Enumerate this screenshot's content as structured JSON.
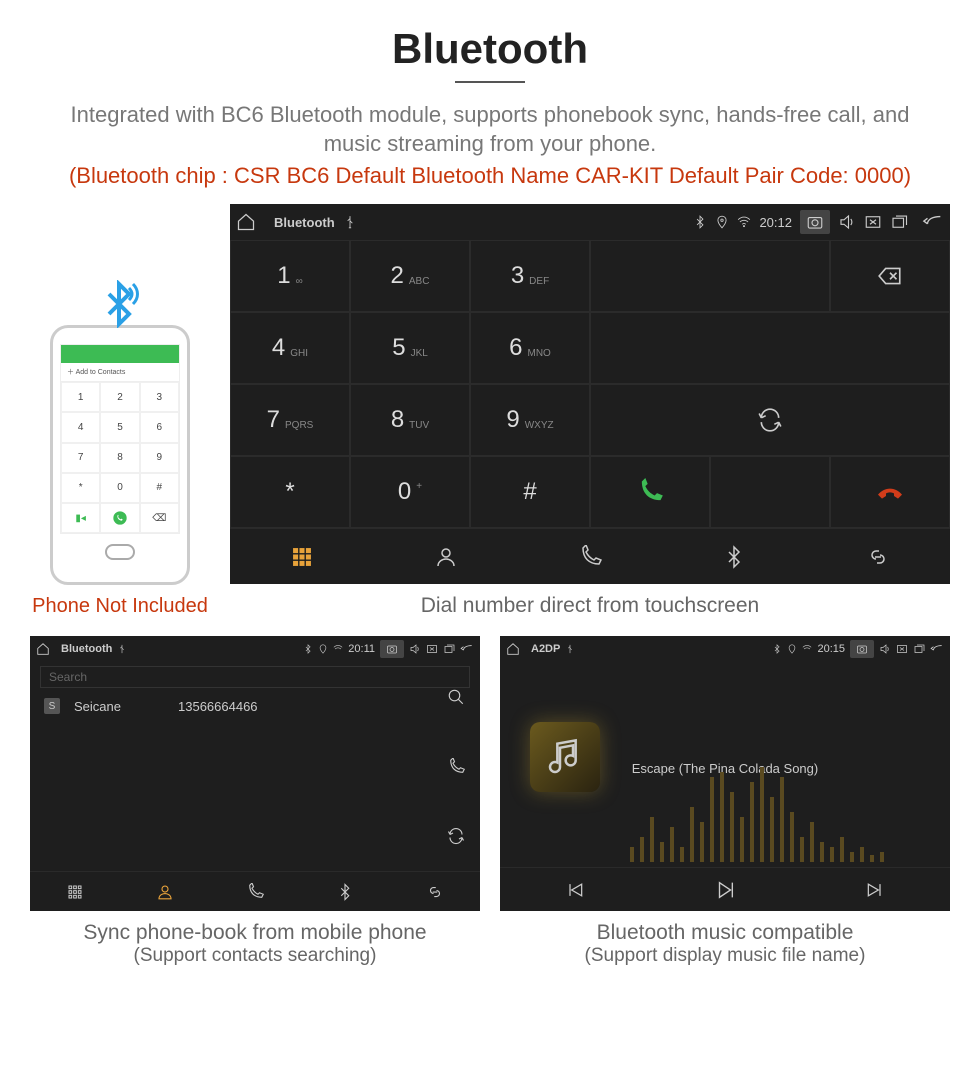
{
  "title": "Bluetooth",
  "description": "Integrated with BC6 Bluetooth module, supports phonebook sync, hands-free call, and music streaming from your phone.",
  "specs": "(Bluetooth chip : CSR BC6     Default Bluetooth Name CAR-KIT     Default Pair Code: 0000)",
  "phone_caption": "Phone Not Included",
  "phone_mock": {
    "add_contacts": "Add to Contacts",
    "keys": [
      "1",
      "2",
      "3",
      "4",
      "5",
      "6",
      "7",
      "8",
      "9",
      "*",
      "0",
      "#"
    ]
  },
  "main_screen": {
    "app_name": "Bluetooth",
    "time": "20:12",
    "caption": "Dial number direct from touchscreen",
    "keys": [
      {
        "n": "1",
        "s": "∞"
      },
      {
        "n": "2",
        "s": "ABC"
      },
      {
        "n": "3",
        "s": "DEF"
      },
      {
        "n": "4",
        "s": "GHI"
      },
      {
        "n": "5",
        "s": "JKL"
      },
      {
        "n": "6",
        "s": "MNO"
      },
      {
        "n": "7",
        "s": "PQRS"
      },
      {
        "n": "8",
        "s": "TUV"
      },
      {
        "n": "9",
        "s": "WXYZ"
      },
      {
        "n": "*",
        "s": ""
      },
      {
        "n": "0",
        "s": "+"
      },
      {
        "n": "#",
        "s": ""
      }
    ]
  },
  "phonebook_screen": {
    "app_name": "Bluetooth",
    "time": "20:11",
    "search_placeholder": "Search",
    "contacts": [
      {
        "initial": "S",
        "name": "Seicane",
        "number": "13566664466"
      }
    ],
    "caption": "Sync phone-book from mobile phone",
    "sub_caption": "(Support contacts searching)"
  },
  "music_screen": {
    "app_name": "A2DP",
    "time": "20:15",
    "track": "Escape (The Pina Colada Song)",
    "caption": "Bluetooth music compatible",
    "sub_caption": "(Support display music file name)"
  }
}
